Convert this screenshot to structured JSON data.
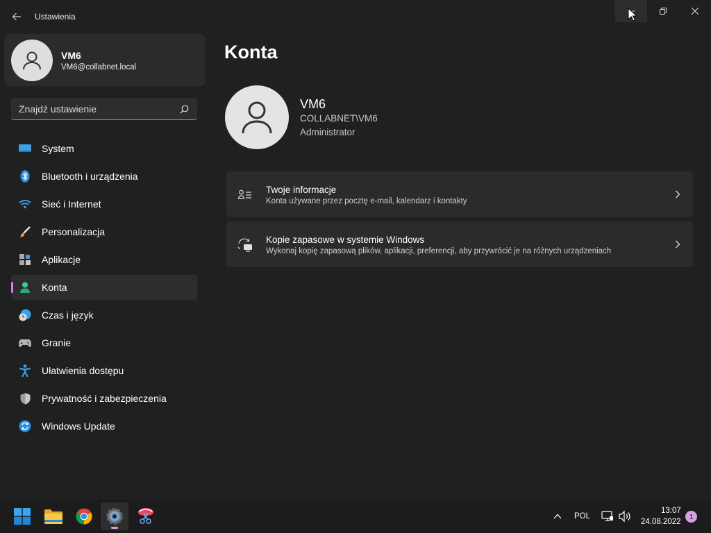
{
  "window": {
    "title": "Ustawienia",
    "controls": [
      "minimize",
      "maximize",
      "close"
    ]
  },
  "profile": {
    "name": "VM6",
    "email": "VM6@collabnet.local"
  },
  "search": {
    "placeholder": "Znajdź ustawienie"
  },
  "sidebar": {
    "items": [
      {
        "label": "System",
        "icon": "system-icon"
      },
      {
        "label": "Bluetooth i urządzenia",
        "icon": "bluetooth-icon"
      },
      {
        "label": "Sieć i Internet",
        "icon": "wifi-icon"
      },
      {
        "label": "Personalizacja",
        "icon": "brush-icon"
      },
      {
        "label": "Aplikacje",
        "icon": "apps-icon"
      },
      {
        "label": "Konta",
        "icon": "account-icon",
        "selected": true
      },
      {
        "label": "Czas i język",
        "icon": "clock-globe-icon"
      },
      {
        "label": "Granie",
        "icon": "gamepad-icon"
      },
      {
        "label": "Ułatwienia dostępu",
        "icon": "accessibility-icon"
      },
      {
        "label": "Prywatność i zabezpieczenia",
        "icon": "shield-icon"
      },
      {
        "label": "Windows Update",
        "icon": "update-icon"
      }
    ]
  },
  "main": {
    "title": "Konta",
    "user": {
      "name": "VM6",
      "domain": "COLLABNET\\VM6",
      "role": "Administrator"
    },
    "cards": [
      {
        "title": "Twoje informacje",
        "subtitle": "Konta używane przez pocztę e-mail, kalendarz i kontakty",
        "icon": "person-list-icon"
      },
      {
        "title": "Kopie zapasowe w systemie Windows",
        "subtitle": "Wykonaj kopię zapasową plików, aplikacji, preferencji, aby przywrócić je na różnych urządzeniach",
        "icon": "backup-sync-icon"
      }
    ]
  },
  "taskbar": {
    "apps": [
      "start-icon",
      "file-explorer-icon",
      "chrome-icon",
      "settings-icon",
      "snipping-tool-icon"
    ],
    "active_app": "settings-icon",
    "language": "POL",
    "time": "13:07",
    "date": "24.08.2022",
    "notification_count": "1"
  },
  "colors": {
    "background": "#202020",
    "card": "#2b2b2b",
    "accent": "#c98bd8",
    "taskbar": "#1c1c1c"
  }
}
